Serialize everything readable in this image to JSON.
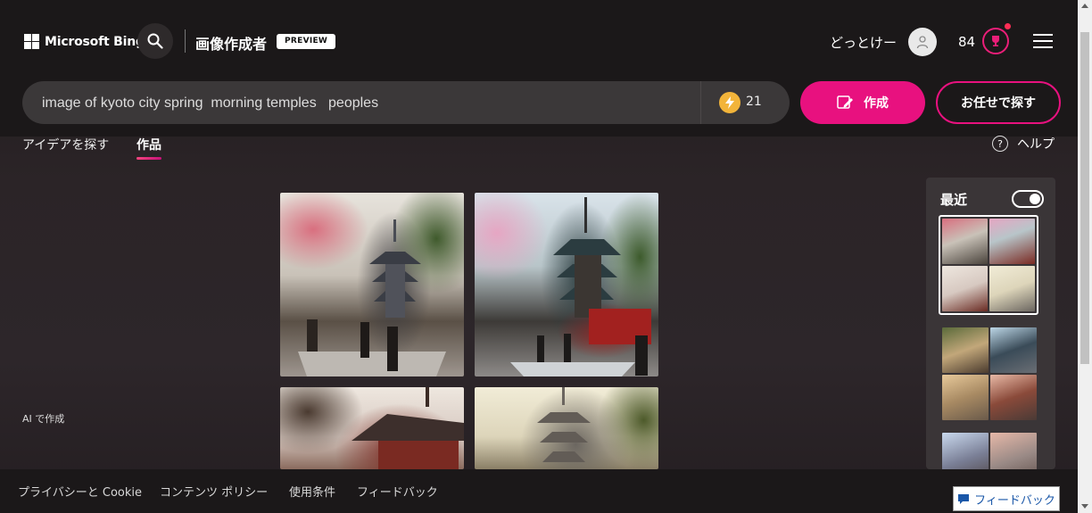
{
  "header": {
    "brand": "Microsoft Bing",
    "app_title": "画像作成者",
    "preview_badge": "PREVIEW",
    "user_name": "どっとけー",
    "points": "84",
    "icons": [
      "windows-logo-icon",
      "search-icon",
      "user-avatar-icon",
      "rewards-trophy-icon",
      "hamburger-menu-icon"
    ]
  },
  "prompt": {
    "value": "image of kyoto city spring  morning temples   peoples",
    "boosts": "21",
    "create_label": "作成",
    "surprise_label": "お任せで探す"
  },
  "tabs": {
    "ideas": "アイデアを探す",
    "creations": "作品",
    "help": "ヘルプ",
    "help_icon": "?"
  },
  "sidebar_left": {
    "ai_made": "AI で作成"
  },
  "recent": {
    "title": "最近",
    "toggle_on": true
  },
  "footer": {
    "links": [
      "プライバシーと Cookie",
      "コンテンツ ポリシー",
      "使用条件",
      "フィードバック"
    ],
    "feedback_button": "フィードバック"
  },
  "colors": {
    "accent": "#e8117f",
    "background": "#2b2427",
    "topbar": "#1b1819",
    "prompt_box": "#3b3839",
    "boost": "#f2b43a"
  }
}
